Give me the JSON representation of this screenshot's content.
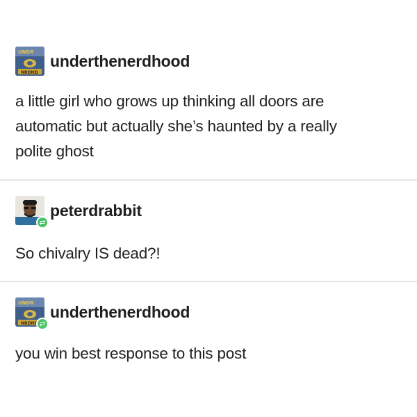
{
  "posts": [
    {
      "username": "underthenerdhood",
      "avatar_icon": "underthenerdhood-avatar",
      "reblog": false,
      "lines": [
        "a little girl who grows up thinking all doors are",
        "automatic but actually she’s haunted by a really",
        "polite ghost"
      ]
    },
    {
      "username": "peterdrabbit",
      "avatar_icon": "peterdrabbit-avatar",
      "reblog": true,
      "lines": [
        "So chivalry IS dead?!"
      ]
    },
    {
      "username": "underthenerdhood",
      "avatar_icon": "underthenerdhood-avatar",
      "reblog": true,
      "lines": [
        "you win best response to this post"
      ]
    }
  ],
  "colors": {
    "reblog_badge": "#4cc46b",
    "divider": "#e4e4e4",
    "text": "#222222"
  }
}
